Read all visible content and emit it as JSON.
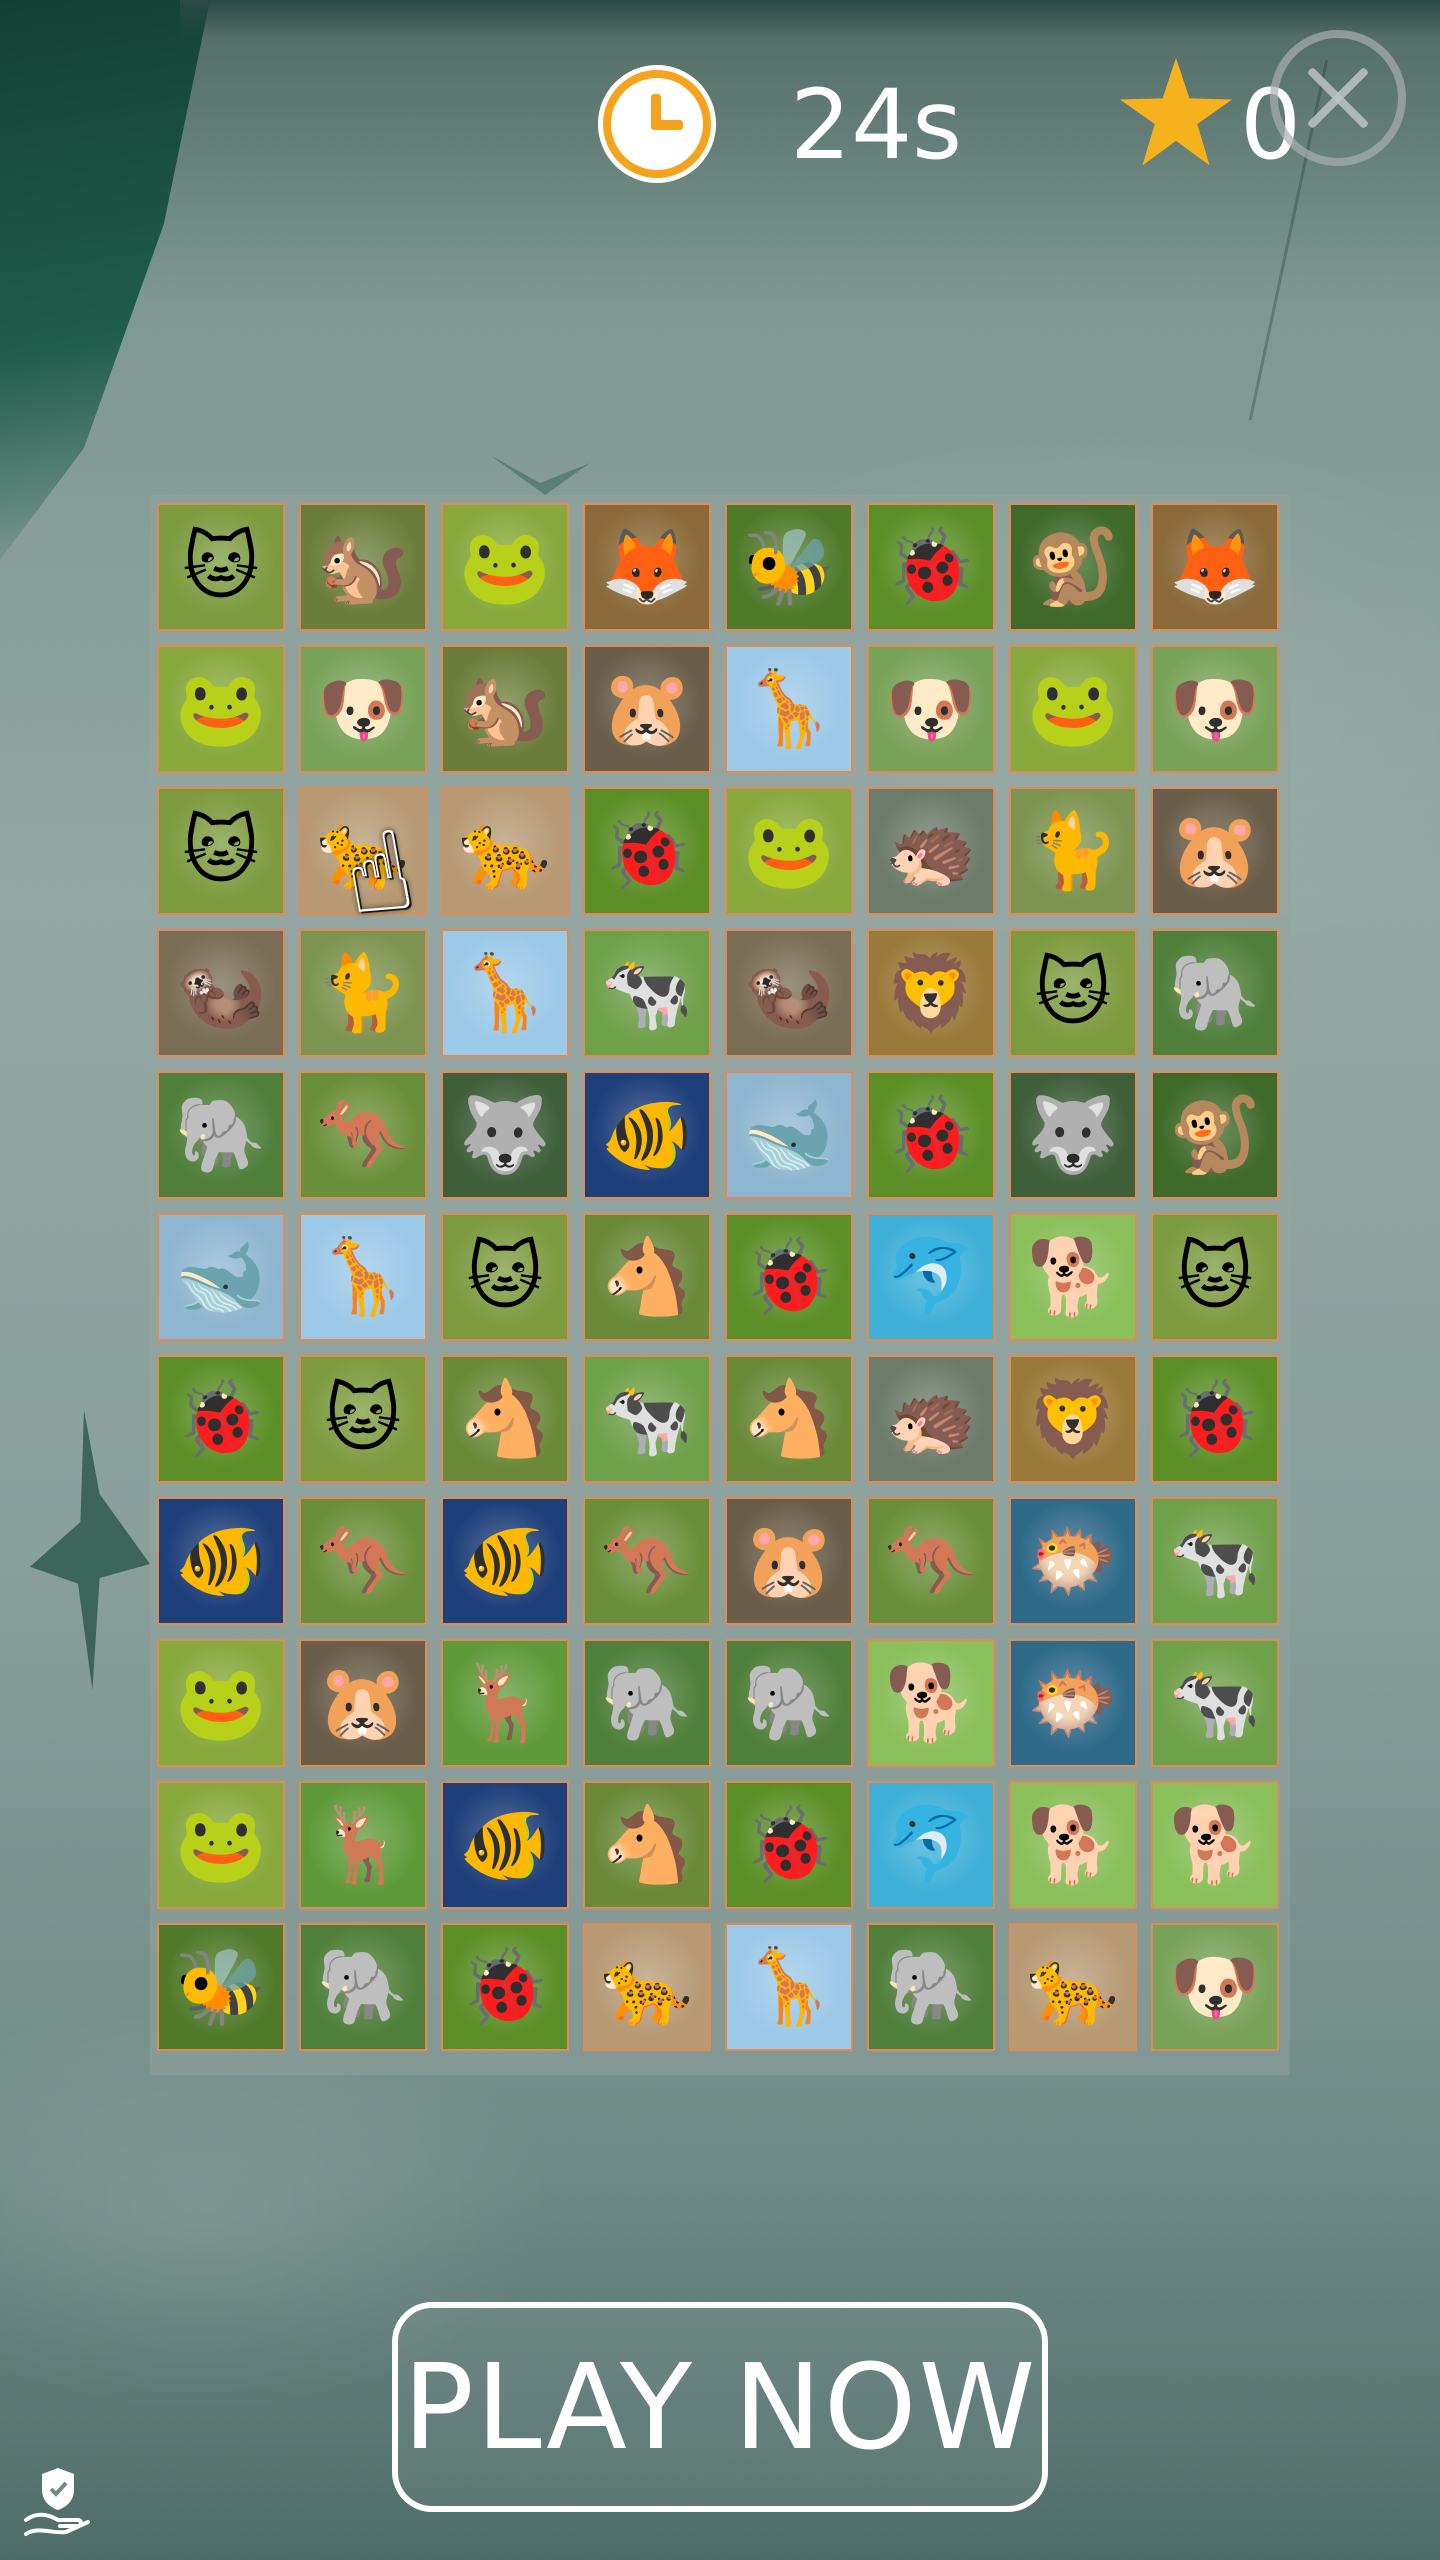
{
  "hud": {
    "timer": "24s",
    "score": "0"
  },
  "icons": {
    "clock": "clock-icon",
    "star": "star-icon",
    "close": "close-icon",
    "pointer": "hand-pointer-icon",
    "privacy": "shield-hand-icon"
  },
  "cta": {
    "label": "PLAY NOW"
  },
  "animals": {
    "kitten": {
      "glyph": "🐱",
      "bg": "#7c9a3e"
    },
    "squirrel": {
      "glyph": "🐿️",
      "bg": "#6b7d3a"
    },
    "frog": {
      "glyph": "🐸",
      "bg": "#87a93d"
    },
    "fox": {
      "glyph": "🦊",
      "bg": "#8a6a3a"
    },
    "bee": {
      "glyph": "🐝",
      "bg": "#4f7a2a"
    },
    "ladybug": {
      "glyph": "🐞",
      "bg": "#5c8f27"
    },
    "chimp": {
      "glyph": "🐒",
      "bg": "#3f6a2a"
    },
    "puppy": {
      "glyph": "🐶",
      "bg": "#7aa35a"
    },
    "hamster": {
      "glyph": "🐹",
      "bg": "#6a5d4a"
    },
    "giraffe": {
      "glyph": "🦒",
      "bg": "#9cc9e8"
    },
    "cheetah": {
      "glyph": "🐆",
      "bg": "#b79a74"
    },
    "hedgehog": {
      "glyph": "🦔",
      "bg": "#6d7b6a"
    },
    "siamese": {
      "glyph": "🐈",
      "bg": "#7d9450"
    },
    "meerkat": {
      "glyph": "🦦",
      "bg": "#7a6d55"
    },
    "cow": {
      "glyph": "🐄",
      "bg": "#6fa04a"
    },
    "lion": {
      "glyph": "🦁",
      "bg": "#9a7a3a"
    },
    "elephant": {
      "glyph": "🐘",
      "bg": "#4f7f3a"
    },
    "kangaroo": {
      "glyph": "🦘",
      "bg": "#6a8f3a"
    },
    "husky": {
      "glyph": "🐺",
      "bg": "#3f5f3a"
    },
    "fish": {
      "glyph": "🐠",
      "bg": "#1f3f7a"
    },
    "orca": {
      "glyph": "🐋",
      "bg": "#8fb6d0"
    },
    "horse": {
      "glyph": "🐴",
      "bg": "#6a8a3a"
    },
    "dolphin": {
      "glyph": "🐬",
      "bg": "#3fb0d8"
    },
    "retriever": {
      "glyph": "🐕",
      "bg": "#8abf5a"
    },
    "clownfish": {
      "glyph": "🐡",
      "bg": "#2f6a8a"
    },
    "deer": {
      "glyph": "🦌",
      "bg": "#5f9a3a"
    }
  },
  "grid": [
    [
      "kitten",
      "squirrel",
      "frog",
      "fox",
      "bee",
      "ladybug",
      "chimp",
      "fox"
    ],
    [
      "frog",
      "puppy",
      "squirrel",
      "hamster",
      "giraffe",
      "puppy",
      "frog",
      "puppy"
    ],
    [
      "kitten",
      "cheetah",
      "cheetah",
      "ladybug",
      "frog",
      "hedgehog",
      "siamese",
      "hamster"
    ],
    [
      "meerkat",
      "siamese",
      "giraffe",
      "cow",
      "meerkat",
      "lion",
      "kitten",
      "elephant"
    ],
    [
      "elephant",
      "kangaroo",
      "husky",
      "fish",
      "orca",
      "ladybug",
      "husky",
      "chimp"
    ],
    [
      "orca",
      "giraffe",
      "kitten",
      "horse",
      "ladybug",
      "dolphin",
      "retriever",
      "kitten"
    ],
    [
      "ladybug",
      "kitten",
      "horse",
      "cow",
      "horse",
      "hedgehog",
      "lion",
      "ladybug"
    ],
    [
      "fish",
      "kangaroo",
      "fish",
      "kangaroo",
      "hamster",
      "kangaroo",
      "clownfish",
      "cow"
    ],
    [
      "frog",
      "hamster",
      "deer",
      "elephant",
      "elephant",
      "retriever",
      "clownfish",
      "cow"
    ],
    [
      "frog",
      "deer",
      "fish",
      "horse",
      "ladybug",
      "dolphin",
      "retriever",
      "retriever"
    ],
    [
      "bee",
      "elephant",
      "ladybug",
      "cheetah",
      "giraffe",
      "elephant",
      "cheetah",
      "puppy"
    ]
  ]
}
